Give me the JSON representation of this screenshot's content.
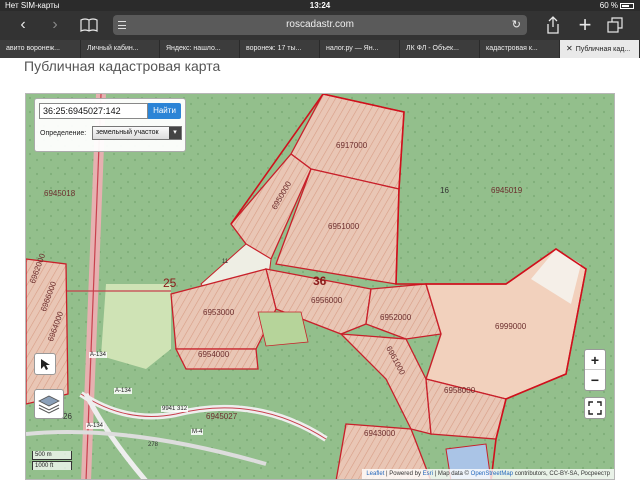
{
  "status_bar": {
    "carrier": "Нет SIM-карты",
    "time": "13:24",
    "battery": "60 %"
  },
  "browser": {
    "url": "roscadastr.com",
    "tabs": [
      {
        "label": "авито воронеж..."
      },
      {
        "label": "Личный кабин..."
      },
      {
        "label": "Яндекс: нашло..."
      },
      {
        "label": "воронеж: 17 ты..."
      },
      {
        "label": "налог.ру — Ян..."
      },
      {
        "label": "ЛК ФЛ - Объек..."
      },
      {
        "label": "кадастровая к..."
      },
      {
        "label": "Публичная кад..."
      }
    ]
  },
  "page": {
    "title": "Публичная кадастровая карта",
    "search": {
      "value": "36:25:6945027:142",
      "button": "Найти"
    },
    "definition": {
      "label": "Определение:",
      "selected": "земельный участок"
    }
  },
  "map": {
    "parcel_labels": [
      "6917000",
      "6950000",
      "6951000",
      "6956000",
      "6953000",
      "6954000",
      "6952000",
      "6999000",
      "6961000",
      "6958000",
      "6943000",
      "6945018",
      "6945019",
      "6945027",
      "6962000",
      "6966000",
      "6964000"
    ],
    "block_labels": [
      "36",
      "25",
      "16",
      "26",
      "11",
      "278"
    ],
    "road_labels": [
      "A-134",
      "A-134",
      "A-134",
      "9941 312",
      "M-4"
    ],
    "scale": {
      "metric": "500 m",
      "imperial": "1000 ft"
    },
    "zoom": {
      "in": "+",
      "out": "−"
    },
    "attribution": {
      "leaflet": "Leaflet",
      "powered": "| Powered by",
      "esri": "Esri",
      "mapdata": "| Map data ©",
      "osm": "OpenStreetMap",
      "rest": "contributors, CC-BY-SA, Росреестр"
    }
  }
}
